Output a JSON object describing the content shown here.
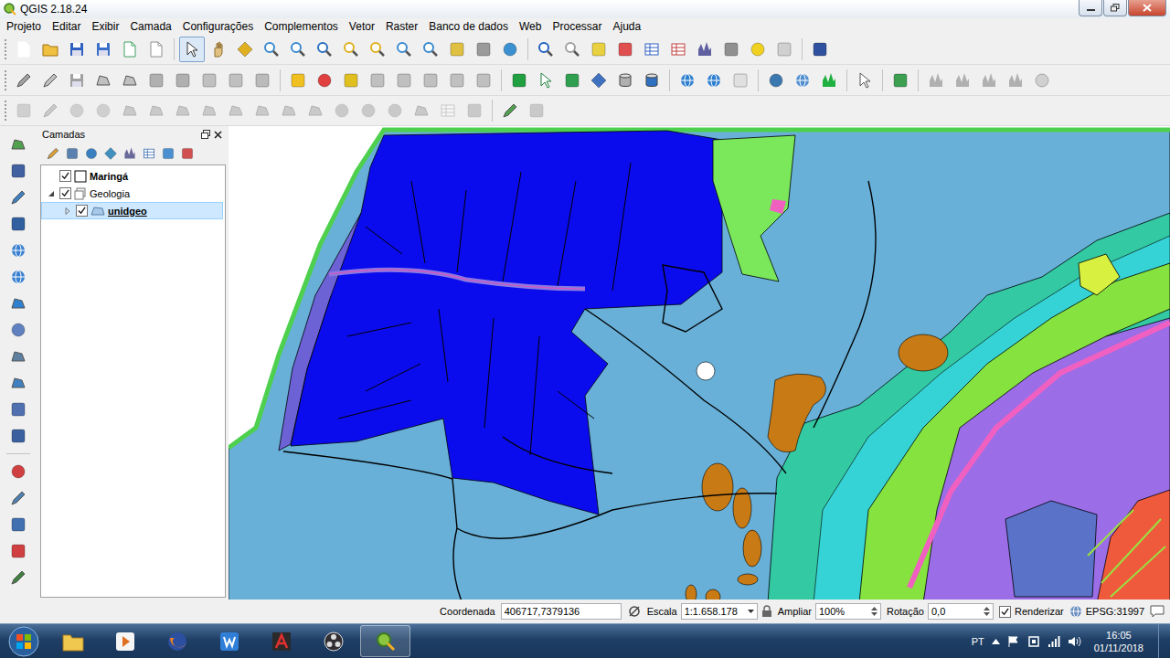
{
  "window": {
    "title": "QGIS 2.18.24"
  },
  "menu": [
    "Projeto",
    "Editar",
    "Exibir",
    "Camada",
    "Configurações",
    "Complementos",
    "Vetor",
    "Raster",
    "Banco de dados",
    "Web",
    "Processar",
    "Ajuda"
  ],
  "layers_panel": {
    "title": "Camadas",
    "layers": [
      {
        "label": "Maringá",
        "kind": "single-symbol",
        "checked": true,
        "bold": true,
        "underlined": false,
        "selected": false,
        "expandable": false,
        "expanded": false,
        "children": []
      },
      {
        "label": "Geologia",
        "kind": "group",
        "checked": true,
        "bold": false,
        "underlined": false,
        "selected": false,
        "expandable": true,
        "expanded": true,
        "children": [
          {
            "label": "unidgeo",
            "kind": "polygon",
            "checked": true,
            "bold": true,
            "underlined": true,
            "selected": true,
            "expandable": true,
            "expanded": false,
            "children": []
          }
        ]
      }
    ]
  },
  "status_bar": {
    "coordinate_label": "Coordenada",
    "coordinate": "406717,7379136",
    "scale_label": "Escala",
    "scale": "1:1.658.178",
    "magnifier_label": "Ampliar",
    "magnifier": "100%",
    "rotation_label": "Rotação",
    "rotation": "0,0",
    "render_label": "Renderizar",
    "render": true,
    "crs": "EPSG:31997"
  },
  "taskbar": {
    "language": "PT",
    "time": "16:05",
    "date": "01/11/2018"
  }
}
